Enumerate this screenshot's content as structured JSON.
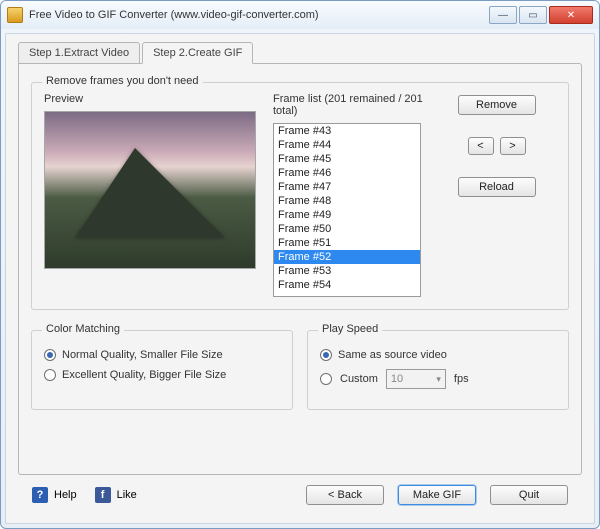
{
  "window": {
    "title": "Free Video to GIF Converter (www.video-gif-converter.com)"
  },
  "tabs": [
    {
      "label": "Step 1.Extract Video"
    },
    {
      "label": "Step 2.Create GIF"
    }
  ],
  "active_tab": 1,
  "remove_group": {
    "legend": "Remove frames you don't need",
    "preview_label": "Preview",
    "framelist_label": "Frame list (201 remained / 201 total)",
    "frames": [
      "Frame #43",
      "Frame #44",
      "Frame #45",
      "Frame #46",
      "Frame #47",
      "Frame #48",
      "Frame #49",
      "Frame #50",
      "Frame #51",
      "Frame #52",
      "Frame #53",
      "Frame #54"
    ],
    "selected_index": 9,
    "btn_remove": "Remove",
    "btn_prev": "<",
    "btn_next": ">",
    "btn_reload": "Reload"
  },
  "color_group": {
    "legend": "Color Matching",
    "opt_normal": "Normal Quality, Smaller File Size",
    "opt_excellent": "Excellent Quality, Bigger File Size",
    "selected": "normal"
  },
  "speed_group": {
    "legend": "Play Speed",
    "opt_same": "Same as source video",
    "opt_custom": "Custom",
    "selected": "same",
    "fps_value": "10",
    "fps_unit": "fps"
  },
  "footer": {
    "help": "Help",
    "like": "Like",
    "back": "< Back",
    "make": "Make GIF",
    "quit": "Quit"
  }
}
